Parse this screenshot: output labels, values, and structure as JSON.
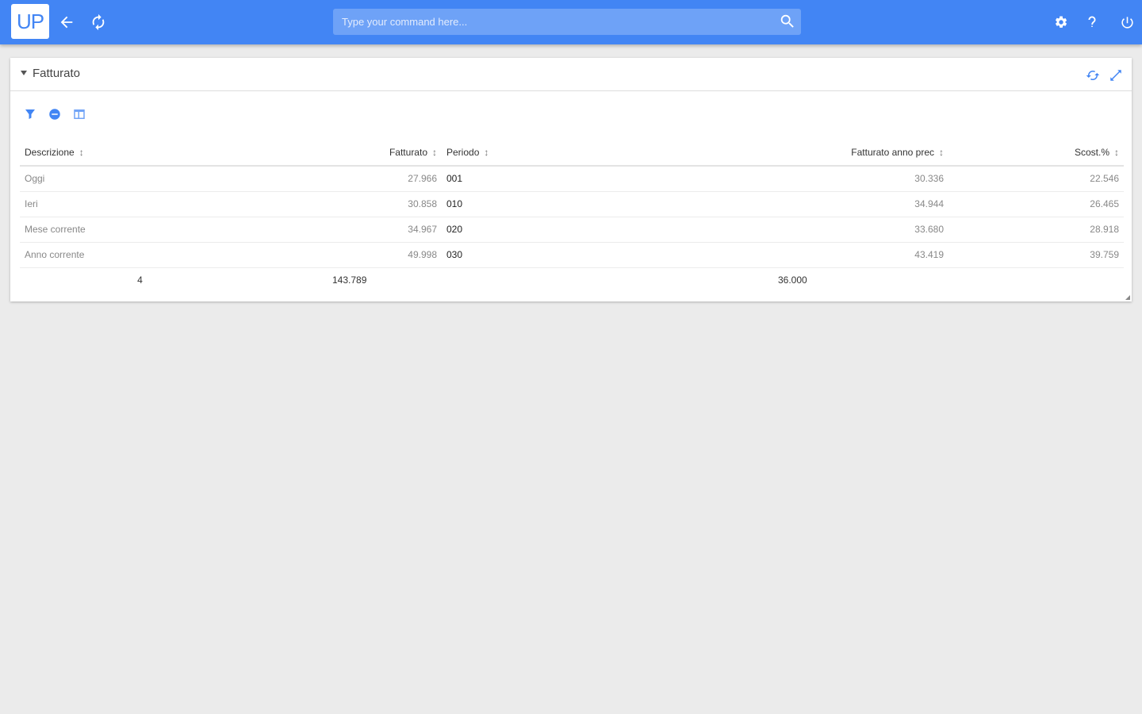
{
  "app": {
    "logo_text": "UP"
  },
  "search": {
    "placeholder": "Type your command here..."
  },
  "panel": {
    "title": "Fatturato"
  },
  "table": {
    "sort_glyph": "↕",
    "columns": [
      "Descrizione",
      "Fatturato",
      "Periodo",
      "Fatturato anno prec",
      "Scost.%"
    ],
    "rows": [
      {
        "descrizione": "Oggi",
        "fatturato": "27.966",
        "periodo": "001",
        "fatturato_prec": "30.336",
        "scost": "22.546"
      },
      {
        "descrizione": "Ieri",
        "fatturato": "30.858",
        "periodo": "010",
        "fatturato_prec": "34.944",
        "scost": "26.465"
      },
      {
        "descrizione": "Mese corrente",
        "fatturato": "34.967",
        "periodo": "020",
        "fatturato_prec": "33.680",
        "scost": "28.918"
      },
      {
        "descrizione": "Anno corrente",
        "fatturato": "49.998",
        "periodo": "030",
        "fatturato_prec": "43.419",
        "scost": "39.759"
      }
    ],
    "footer": {
      "count": "4",
      "fatturato_total": "143.789",
      "periodo_total": "36.000"
    }
  },
  "colors": {
    "accent": "#4285f4",
    "background": "#ebebeb"
  }
}
